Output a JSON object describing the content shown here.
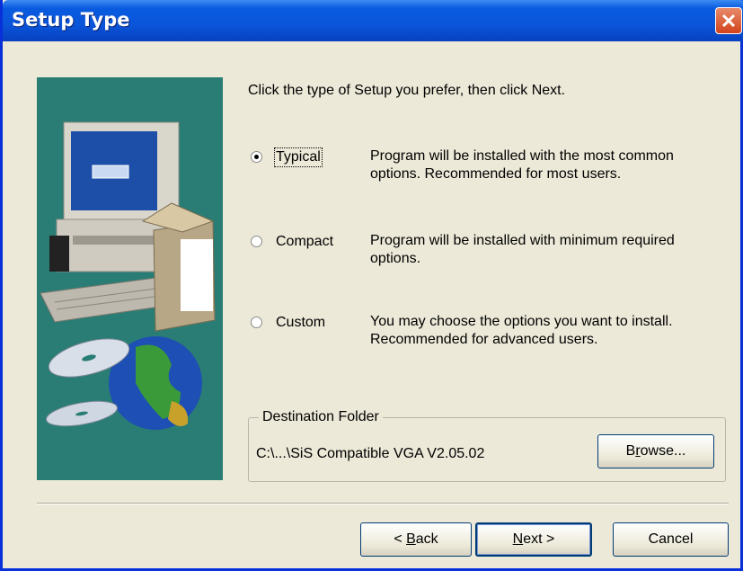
{
  "window": {
    "title": "Setup Type"
  },
  "prompt": "Click the type of Setup you prefer, then click Next.",
  "options": [
    {
      "label": "Typical",
      "selected": true,
      "description_line1": "Program will be installed with the most common",
      "description_line2": "options. Recommended for most users."
    },
    {
      "label": "Compact",
      "selected": false,
      "description_line1": "Program will be installed with minimum required",
      "description_line2": "options."
    },
    {
      "label": "Custom",
      "selected": false,
      "description_line1": "You may choose the options you want to install.",
      "description_line2": "Recommended for advanced users."
    }
  ],
  "destination": {
    "group_label": "Destination Folder",
    "path": "C:\\...\\SiS Compatible VGA V2.05.02",
    "browse_label_pre": "B",
    "browse_label_u": "r",
    "browse_label_post": "owse..."
  },
  "buttons": {
    "back_pre": "< ",
    "back_u": "B",
    "back_post": "ack",
    "next_u": "N",
    "next_post": "ext >",
    "cancel": "Cancel"
  },
  "colors": {
    "titlebar": "#0a55d9",
    "art_background": "#2a7d74",
    "dialog_bg": "#ece9d8"
  }
}
